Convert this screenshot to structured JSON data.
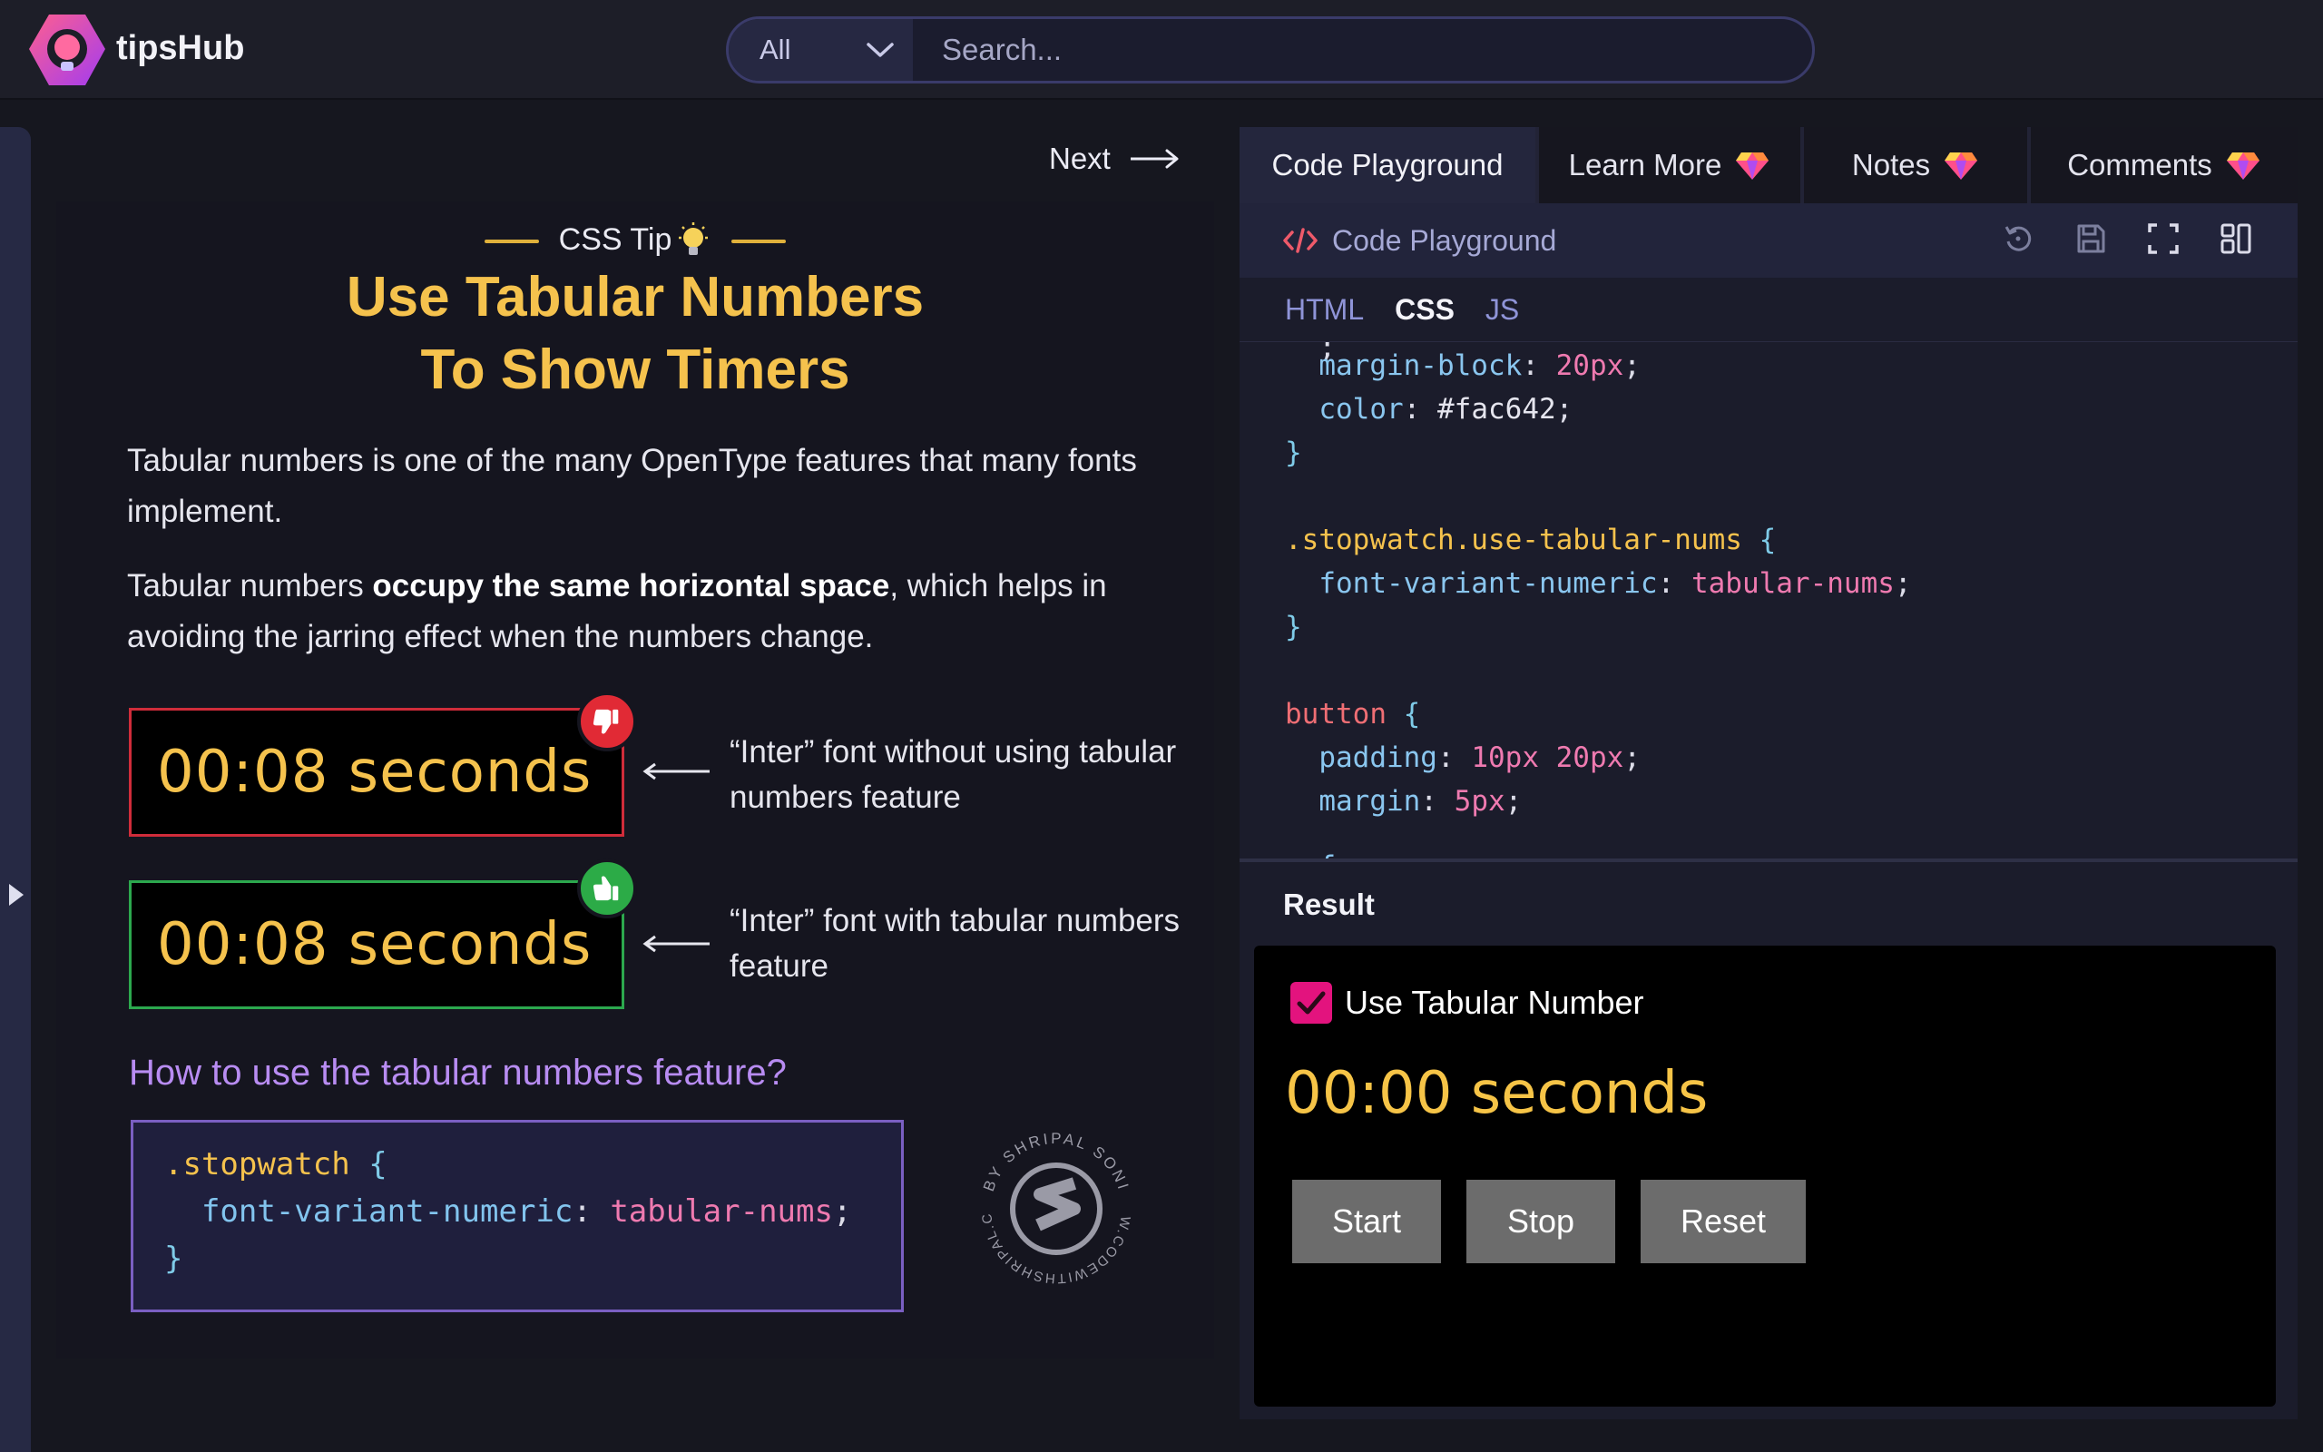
{
  "app": {
    "name": "tipsHub"
  },
  "search": {
    "category": "All",
    "placeholder": "Search..."
  },
  "nav": {
    "next_label": "Next"
  },
  "tip": {
    "kicker": "CSS Tip",
    "title_line1": "Use Tabular Numbers",
    "title_line2": "To Show Timers",
    "para1": "Tabular numbers is one of the many OpenType features that many fonts implement.",
    "para2_before": "Tabular numbers ",
    "para2_bold": "occupy the same horizontal space",
    "para2_after": ", which helps in avoiding the jarring effect when the numbers change.",
    "demo_without": {
      "text": "00:08 seconds",
      "caption": "“Inter” font without using tabular numbers feature",
      "status": "thumbs-down"
    },
    "demo_with": {
      "text": "00:08 seconds",
      "caption": "“Inter” font with tabular numbers feature",
      "status": "thumbs-up"
    },
    "howto_heading": "How to use the tabular numbers feature?",
    "snippet": {
      "selector": ".stopwatch",
      "open_brace": "{",
      "property": "font-variant-numeric",
      "colon": ":",
      "value": "tabular-nums",
      "semicolon": ";",
      "close_brace": "}"
    },
    "watermark": {
      "top_text": "BY SHRIPAL SONI",
      "bottom_text": "WWW.CODEWITHSHRIPAL.COM"
    }
  },
  "panel": {
    "tabs": [
      {
        "label": "Code Playground",
        "active": true,
        "premium": false
      },
      {
        "label": "Learn More",
        "active": false,
        "premium": true
      },
      {
        "label": "Notes",
        "active": false,
        "premium": true
      },
      {
        "label": "Comments",
        "active": false,
        "premium": true
      }
    ],
    "playground_title": "Code Playground",
    "tools": [
      "reset-icon",
      "save-icon",
      "fullscreen-icon",
      "layout-icon"
    ],
    "lang_tabs": [
      {
        "label": "HTML",
        "active": false
      },
      {
        "label": "CSS",
        "active": true
      },
      {
        "label": "JS",
        "active": false
      }
    ],
    "code": {
      "l1_prop": "margin-block",
      "l1_val": "20px",
      "l2_prop": "color",
      "l2_val": "#fac642",
      "l3_close": "}",
      "l4_sel": ".stopwatch.use-tabular-nums",
      "l4_open": "{",
      "l5_prop": "font-variant-numeric",
      "l5_val": "tabular-nums",
      "l6_close": "}",
      "l7_tag": "button",
      "l7_open": "{",
      "l8_prop": "padding",
      "l8_val": "10px 20px",
      "l9_prop": "margin",
      "l9_val": "5px"
    },
    "result_label": "Result",
    "result": {
      "checkbox_label": "Use Tabular Number",
      "checkbox_checked": true,
      "timer": "00:00 seconds",
      "buttons": {
        "start": "Start",
        "stop": "Stop",
        "reset": "Reset"
      }
    }
  },
  "colors": {
    "accent_yellow": "#f5c24d",
    "accent_pink": "#e3137e",
    "bad_red": "#d02c3a",
    "good_green": "#2ca84e"
  }
}
